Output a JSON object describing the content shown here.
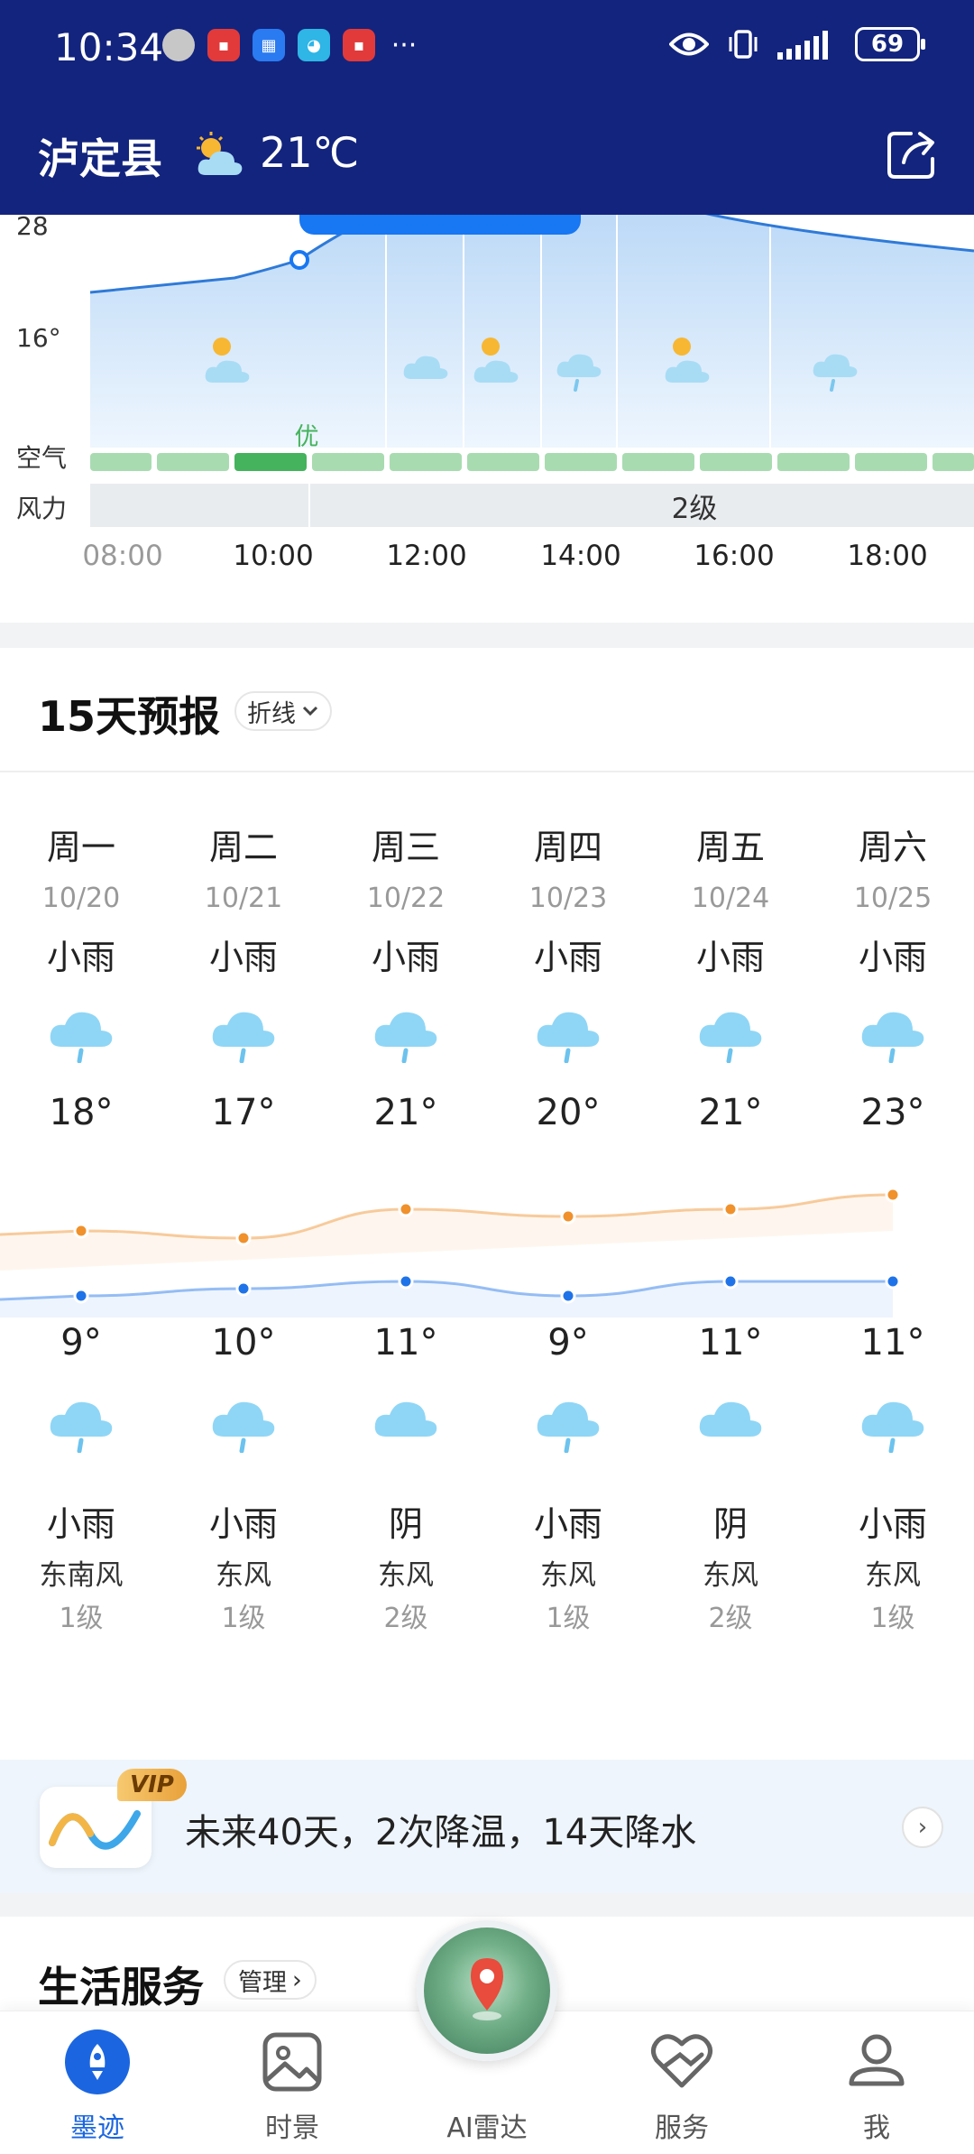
{
  "status_bar": {
    "time": "10:34",
    "battery": "69",
    "overflow": "···"
  },
  "header": {
    "city": "泸定县",
    "temperature": "21℃",
    "weather_icon": "partly-cloudy-icon",
    "share_icon": "share-icon"
  },
  "hourly": {
    "y_labels": [
      "28",
      "16°"
    ],
    "row_labels": {
      "air": "空气",
      "wind": "力"
    },
    "row_label_wind_prefix": "风",
    "air_label": "优",
    "wind_level": "2级",
    "hours": [
      "08:00",
      "10:00",
      "12:00",
      "14:00",
      "16:00",
      "18:00"
    ],
    "icons": [
      "partly-cloudy-icon",
      "cloudy-icon",
      "partly-cloudy-icon",
      "rain-cloud-icon",
      "partly-cloudy-icon",
      "rain-cloud-icon"
    ],
    "accent": "#1877f2"
  },
  "forecast": {
    "title": "15天预报",
    "mode": "折线",
    "days": [
      {
        "week": "周一",
        "date": "10/20",
        "day_cond": "小雨",
        "high": "18°",
        "low": "9°",
        "night_cond": "小雨",
        "wind_dir": "东南风",
        "wind_level": "1级",
        "day_icon": "light-rain-icon",
        "night_icon": "light-rain-icon"
      },
      {
        "week": "周二",
        "date": "10/21",
        "day_cond": "小雨",
        "high": "17°",
        "low": "10°",
        "night_cond": "小雨",
        "wind_dir": "东风",
        "wind_level": "1级",
        "day_icon": "light-rain-icon",
        "night_icon": "light-rain-icon"
      },
      {
        "week": "周三",
        "date": "10/22",
        "day_cond": "小雨",
        "high": "21°",
        "low": "11°",
        "night_cond": "阴",
        "wind_dir": "东风",
        "wind_level": "2级",
        "day_icon": "light-rain-icon",
        "night_icon": "overcast-icon"
      },
      {
        "week": "周四",
        "date": "10/23",
        "day_cond": "小雨",
        "high": "20°",
        "low": "9°",
        "night_cond": "小雨",
        "wind_dir": "东风",
        "wind_level": "1级",
        "day_icon": "light-rain-icon",
        "night_icon": "light-rain-icon"
      },
      {
        "week": "周五",
        "date": "10/24",
        "day_cond": "小雨",
        "high": "21°",
        "low": "11°",
        "night_cond": "阴",
        "wind_dir": "东风",
        "wind_level": "2级",
        "day_icon": "light-rain-icon",
        "night_icon": "overcast-icon"
      },
      {
        "week": "周六",
        "date": "10/25",
        "day_cond": "小雨",
        "high": "23°",
        "low": "11°",
        "night_cond": "小雨",
        "wind_dir": "东风",
        "wind_level": "1级",
        "day_icon": "light-rain-icon",
        "night_icon": "light-rain-icon"
      }
    ],
    "high_values": [
      18,
      17,
      21,
      20,
      21,
      23
    ],
    "low_values": [
      9,
      10,
      11,
      9,
      11,
      11
    ],
    "high_color": "#f0912c",
    "low_color": "#1f73e8"
  },
  "vip": {
    "badge": "VIP",
    "text": "未来40天，2次降温，14天降水",
    "arrow": "›"
  },
  "life": {
    "title": "生活服务",
    "manage": "管理",
    "manage_chev": "›"
  },
  "nav": {
    "items": [
      {
        "label": "墨迹",
        "icon": "rocket-icon",
        "active": true
      },
      {
        "label": "时景",
        "icon": "photo-icon",
        "active": false
      },
      {
        "label": "AI雷达",
        "icon": "radar-icon",
        "active": false
      },
      {
        "label": "服务",
        "icon": "service-heart-icon",
        "active": false
      },
      {
        "label": "我",
        "icon": "profile-icon",
        "active": false
      }
    ]
  }
}
